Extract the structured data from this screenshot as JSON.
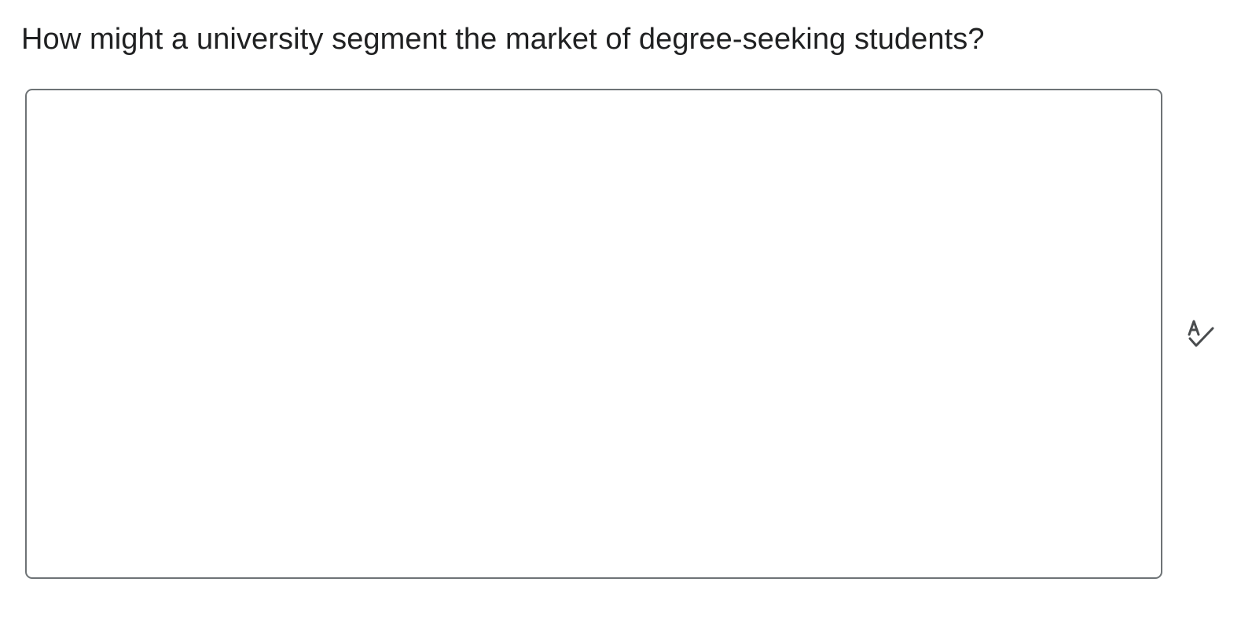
{
  "question": {
    "text": "How might a university segment the market of degree-seeking students?"
  },
  "answer": {
    "value": "",
    "placeholder": ""
  },
  "icons": {
    "spellcheck": "spellcheck-icon"
  },
  "colors": {
    "text": "#202122",
    "border": "#6e7376",
    "icon": "#494c4e"
  }
}
